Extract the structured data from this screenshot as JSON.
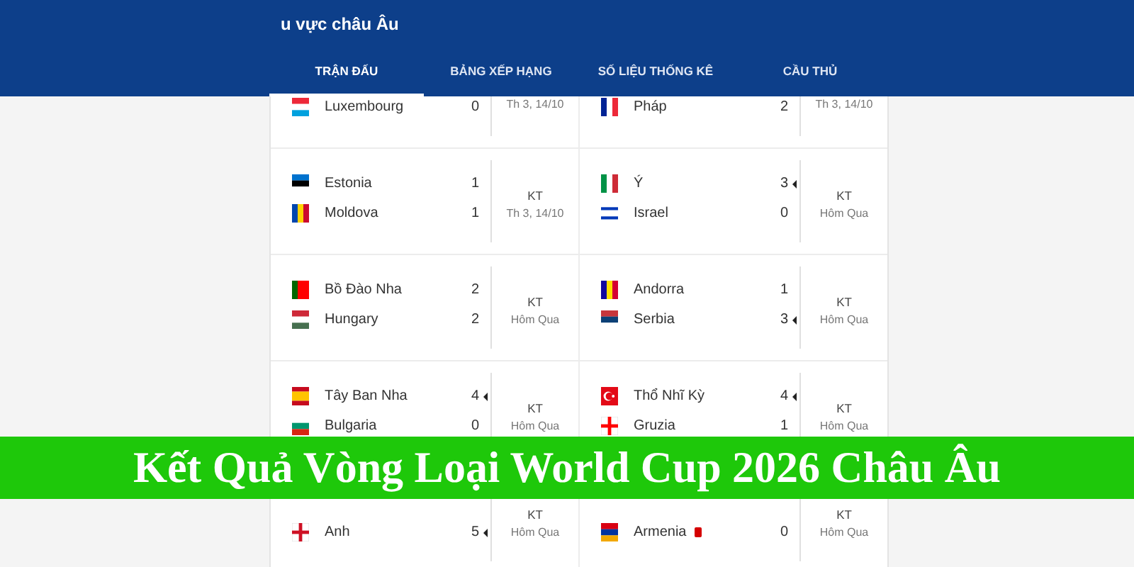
{
  "header": {
    "title": "u vực châu Âu",
    "tabs": [
      {
        "label": "TRẬN ĐẤU",
        "selected": true
      },
      {
        "label": "BẢNG XẾP HẠNG",
        "selected": false
      },
      {
        "label": "SỐ LIỆU THỐNG KÊ",
        "selected": false
      },
      {
        "label": "CẦU THỦ",
        "selected": false
      }
    ]
  },
  "rows": [
    {
      "matches": [
        {
          "date": "Th 3, 14/10",
          "teams": [
            {
              "name": "Luxembourg",
              "score": "0",
              "winner": false,
              "red_card": false
            }
          ]
        },
        {
          "date": "Th 3, 14/10",
          "teams": [
            {
              "name": "Pháp",
              "score": "2",
              "winner": false,
              "red_card": false
            }
          ]
        }
      ]
    },
    {
      "matches": [
        {
          "result": "KT",
          "date": "Th 3, 14/10",
          "teams": [
            {
              "name": "Estonia",
              "score": "1",
              "winner": false,
              "red_card": false
            },
            {
              "name": "Moldova",
              "score": "1",
              "winner": false,
              "red_card": false
            }
          ]
        },
        {
          "result": "KT",
          "date": "Hôm Qua",
          "teams": [
            {
              "name": "Ý",
              "score": "3",
              "winner": true,
              "red_card": false
            },
            {
              "name": "Israel",
              "score": "0",
              "winner": false,
              "red_card": false
            }
          ]
        }
      ]
    },
    {
      "matches": [
        {
          "result": "KT",
          "date": "Hôm Qua",
          "teams": [
            {
              "name": "Bồ Đào Nha",
              "score": "2",
              "winner": false,
              "red_card": false
            },
            {
              "name": "Hungary",
              "score": "2",
              "winner": false,
              "red_card": false
            }
          ]
        },
        {
          "result": "KT",
          "date": "Hôm Qua",
          "teams": [
            {
              "name": "Andorra",
              "score": "1",
              "winner": false,
              "red_card": false
            },
            {
              "name": "Serbia",
              "score": "3",
              "winner": true,
              "red_card": false
            }
          ]
        }
      ]
    },
    {
      "matches": [
        {
          "result": "KT",
          "date": "Hôm Qua",
          "teams": [
            {
              "name": "Tây Ban Nha",
              "score": "4",
              "winner": true,
              "red_card": false
            },
            {
              "name": "Bulgaria",
              "score": "0",
              "winner": false,
              "red_card": false
            }
          ]
        },
        {
          "result": "KT",
          "date": "Hôm Qua",
          "teams": [
            {
              "name": "Thổ Nhĩ Kỳ",
              "score": "4",
              "winner": true,
              "red_card": false
            },
            {
              "name": "Gruzia",
              "score": "1",
              "winner": false,
              "red_card": false
            }
          ]
        }
      ]
    },
    {
      "matches": [
        {
          "result": "KT",
          "date": "Hôm Qua",
          "teams": [
            {
              "name": "Anh",
              "score": "5",
              "winner": true,
              "red_card": false
            }
          ]
        },
        {
          "result": "KT",
          "date": "Hôm Qua",
          "teams": [
            {
              "name": "Armenia",
              "score": "0",
              "winner": false,
              "red_card": true
            }
          ]
        }
      ]
    }
  ],
  "banner": {
    "text": "Kết Quả Vòng Loại World Cup 2026 Châu Âu"
  }
}
